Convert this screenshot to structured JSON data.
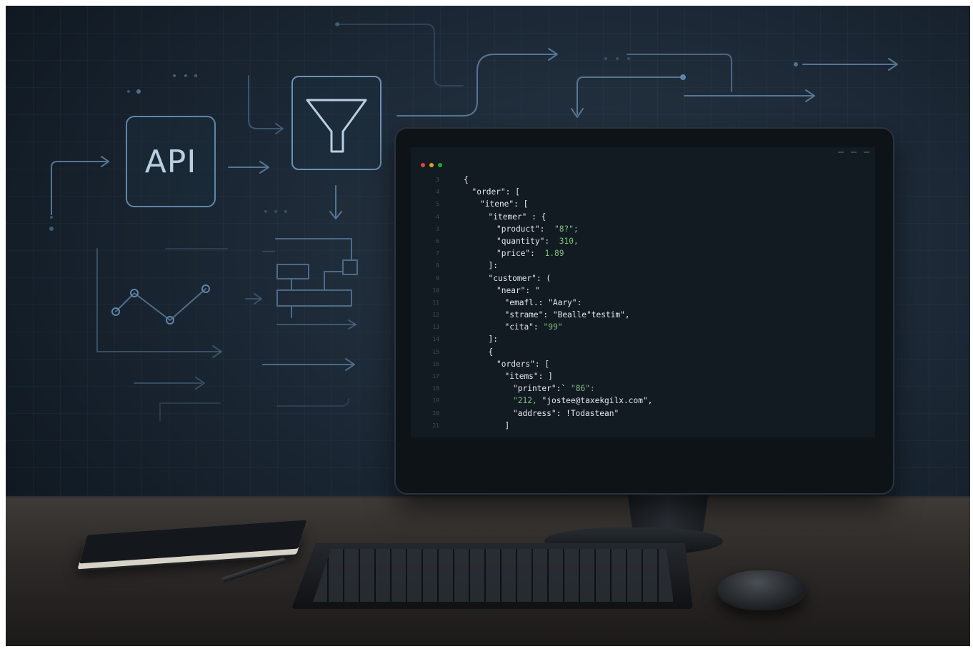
{
  "diagram": {
    "api_label": "API"
  },
  "editor": {
    "line_numbers": [
      "3",
      "4",
      "5",
      "4",
      "3",
      "6",
      "7",
      "8",
      "9",
      "10",
      "11",
      "12",
      "13",
      "14",
      "15",
      "16",
      "17",
      "18",
      "19",
      "20",
      "21"
    ],
    "lines": [
      {
        "indent": 0,
        "parts": [
          {
            "t": "{",
            "c": "str"
          }
        ]
      },
      {
        "indent": 1,
        "parts": [
          {
            "t": "\"order\": [",
            "c": "str"
          }
        ]
      },
      {
        "indent": 2,
        "parts": [
          {
            "t": "\"itene\": [",
            "c": "str"
          }
        ]
      },
      {
        "indent": 3,
        "parts": [
          {
            "t": "\"itemer\" : {",
            "c": "str"
          }
        ]
      },
      {
        "indent": 4,
        "parts": [
          {
            "t": "\"product\":  ",
            "c": "str"
          },
          {
            "t": "\"8?\";",
            "c": "val"
          }
        ]
      },
      {
        "indent": 4,
        "parts": [
          {
            "t": "\"quantity\":  ",
            "c": "str"
          },
          {
            "t": "310,",
            "c": "val"
          }
        ]
      },
      {
        "indent": 4,
        "parts": [
          {
            "t": "\"price\":  ",
            "c": "str"
          },
          {
            "t": "1.89",
            "c": "val"
          }
        ]
      },
      {
        "indent": 3,
        "parts": [
          {
            "t": "]:",
            "c": "str"
          }
        ]
      },
      {
        "indent": 3,
        "parts": [
          {
            "t": "\"customer\": (",
            "c": "str"
          }
        ]
      },
      {
        "indent": 4,
        "parts": [
          {
            "t": "\"near\": \"",
            "c": "str"
          }
        ]
      },
      {
        "indent": 5,
        "parts": [
          {
            "t": "\"emafl.: \"Aary\":",
            "c": "str"
          }
        ]
      },
      {
        "indent": 5,
        "parts": [
          {
            "t": "\"strame\": \"Bealle\"testim\",",
            "c": "str"
          }
        ]
      },
      {
        "indent": 5,
        "parts": [
          {
            "t": "\"cita\": ",
            "c": "str"
          },
          {
            "t": "\"99\"",
            "c": "val"
          }
        ]
      },
      {
        "indent": 3,
        "parts": [
          {
            "t": "]:",
            "c": "str"
          }
        ]
      },
      {
        "indent": 3,
        "parts": [
          {
            "t": "{",
            "c": "str"
          }
        ]
      },
      {
        "indent": 4,
        "parts": [
          {
            "t": "\"orders\": [",
            "c": "str"
          }
        ]
      },
      {
        "indent": 5,
        "parts": [
          {
            "t": "\"items\": ]",
            "c": "str"
          }
        ]
      },
      {
        "indent": 6,
        "parts": [
          {
            "t": "\"printer\":` ",
            "c": "str"
          },
          {
            "t": "\"86\":",
            "c": "val"
          }
        ]
      },
      {
        "indent": 6,
        "parts": [
          {
            "t": "\"212, ",
            "c": "val"
          },
          {
            "t": "\"jostee@taxekgilx.com\",",
            "c": "str"
          }
        ]
      },
      {
        "indent": 6,
        "parts": [
          {
            "t": "\"address\": !Todastean\"",
            "c": "str"
          }
        ]
      },
      {
        "indent": 5,
        "parts": [
          {
            "t": "]",
            "c": "str"
          }
        ]
      }
    ]
  },
  "colors": {
    "accent_line": "#5f86a8",
    "code_text": "#e4e9ee",
    "code_value": "#7fc27d",
    "dot_red": "#e0443e",
    "dot_yellow": "#dea123",
    "dot_green": "#1aab29"
  }
}
